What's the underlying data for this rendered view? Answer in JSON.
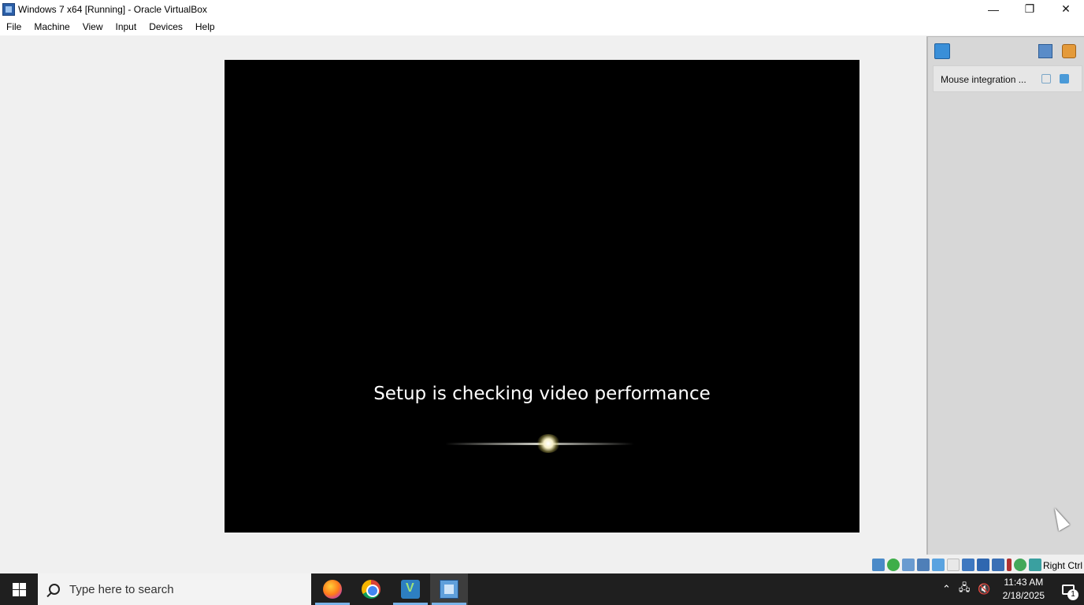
{
  "window": {
    "title": "Windows 7 x64 [Running] - Oracle VirtualBox",
    "icon": "virtualbox-icon",
    "controls": {
      "minimize": "—",
      "restore": "❐",
      "close": "✕"
    }
  },
  "menu": {
    "items": [
      "File",
      "Machine",
      "View",
      "Input",
      "Devices",
      "Help"
    ]
  },
  "vm_screen": {
    "message": "Setup is checking video performance"
  },
  "side_panel": {
    "notice_text": "Mouse integration ..."
  },
  "status_bar": {
    "icons": [
      "hard-disk-icon",
      "optical-drive-icon",
      "audio-icon",
      "network-icon",
      "usb-icon",
      "shared-folders-icon",
      "display-icon",
      "video-capture-icon",
      "recording-icon",
      "cpu-icon",
      "guest-additions-icon",
      "mouse-integration-icon"
    ],
    "host_key": "Right Ctrl"
  },
  "taskbar": {
    "search_placeholder": "Type here to search",
    "apps": [
      "firefox-icon",
      "chrome-icon",
      "virtualbox-manager-icon",
      "virtualbox-vm-icon"
    ],
    "clock_time": "11:43 AM",
    "clock_date": "2/18/2025",
    "notification_count": "1"
  },
  "colors": {
    "vm_background": "#000000",
    "taskbar": "#1f1f1f",
    "side_panel": "#d7d7d7",
    "accent": "#7ab3e8"
  }
}
